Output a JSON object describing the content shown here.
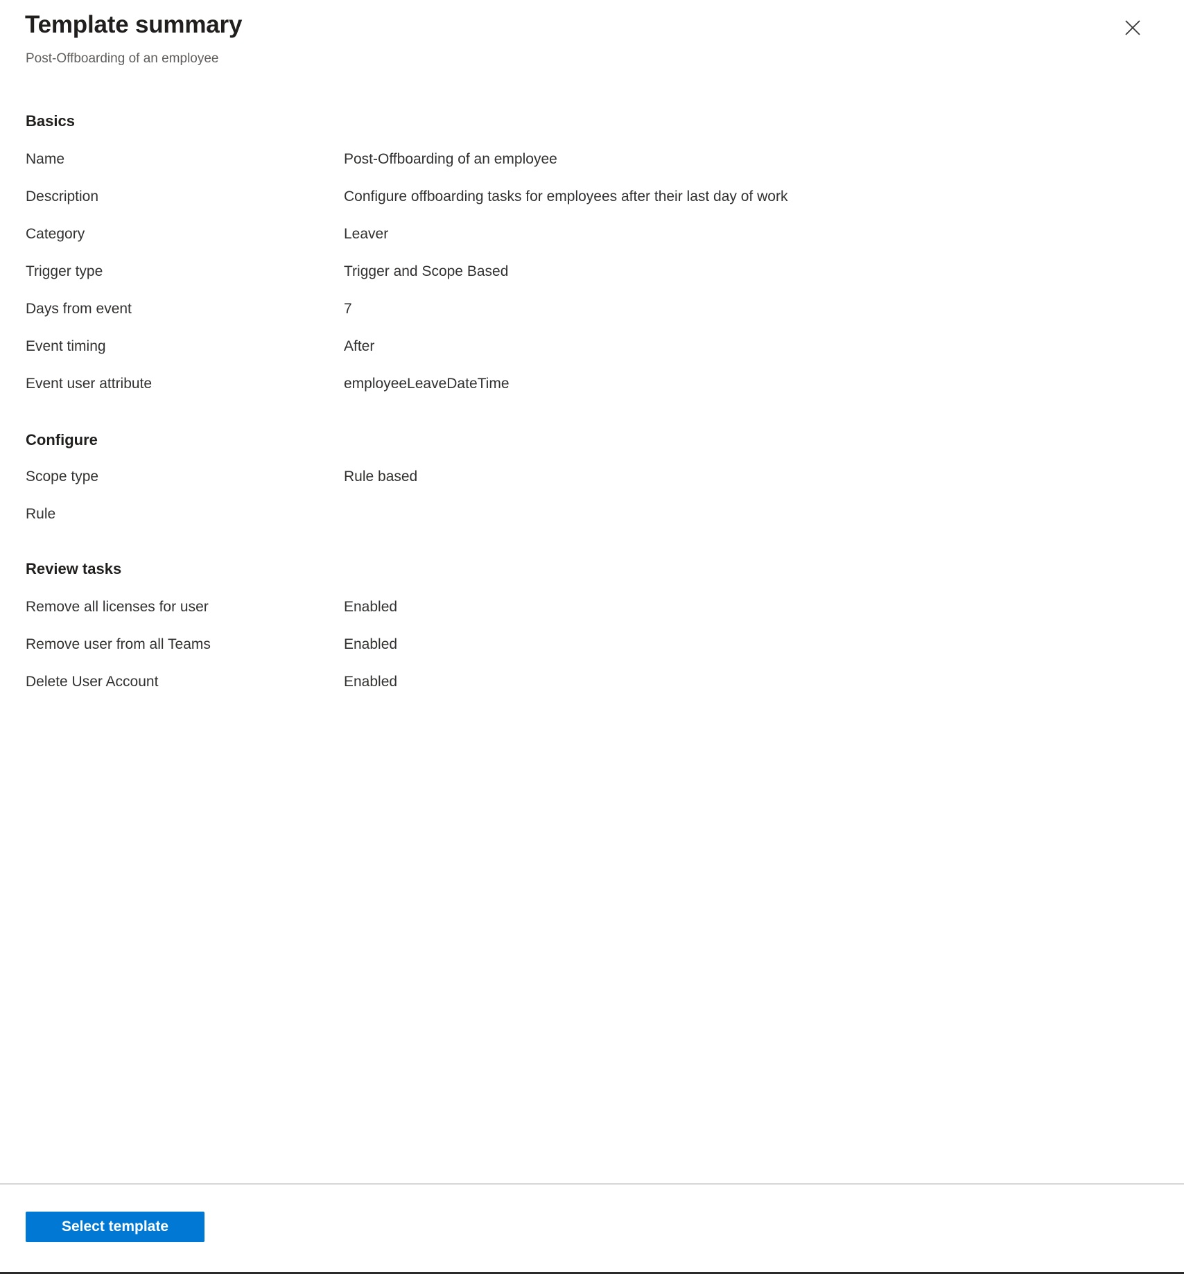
{
  "header": {
    "title": "Template summary",
    "subtitle": "Post-Offboarding of an employee",
    "close_icon": "close-icon"
  },
  "sections": [
    {
      "heading": "Basics",
      "rows": [
        {
          "label": "Name",
          "value": "Post-Offboarding of an employee"
        },
        {
          "label": "Description",
          "value": "Configure offboarding tasks for employees after their last day of work"
        },
        {
          "label": "Category",
          "value": "Leaver"
        },
        {
          "label": "Trigger type",
          "value": "Trigger and Scope Based"
        },
        {
          "label": "Days from event",
          "value": "7"
        },
        {
          "label": "Event timing",
          "value": "After"
        },
        {
          "label": "Event user attribute",
          "value": "employeeLeaveDateTime"
        }
      ]
    },
    {
      "heading": "Configure",
      "rows": [
        {
          "label": "Scope type",
          "value": "Rule based"
        },
        {
          "label": "Rule",
          "value": ""
        }
      ]
    },
    {
      "heading": "Review tasks",
      "rows": [
        {
          "label": "Remove all licenses for user",
          "value": "Enabled"
        },
        {
          "label": "Remove user from all Teams",
          "value": "Enabled"
        },
        {
          "label": "Delete User Account",
          "value": "Enabled"
        }
      ]
    }
  ],
  "footer": {
    "select_template_label": "Select template"
  },
  "colors": {
    "accent": "#0078d4",
    "heading_text": "#201f1e",
    "body_text": "#323130",
    "subtle_text": "#605e5c",
    "divider": "#d6d6d6",
    "page_background": "#ffffff"
  }
}
